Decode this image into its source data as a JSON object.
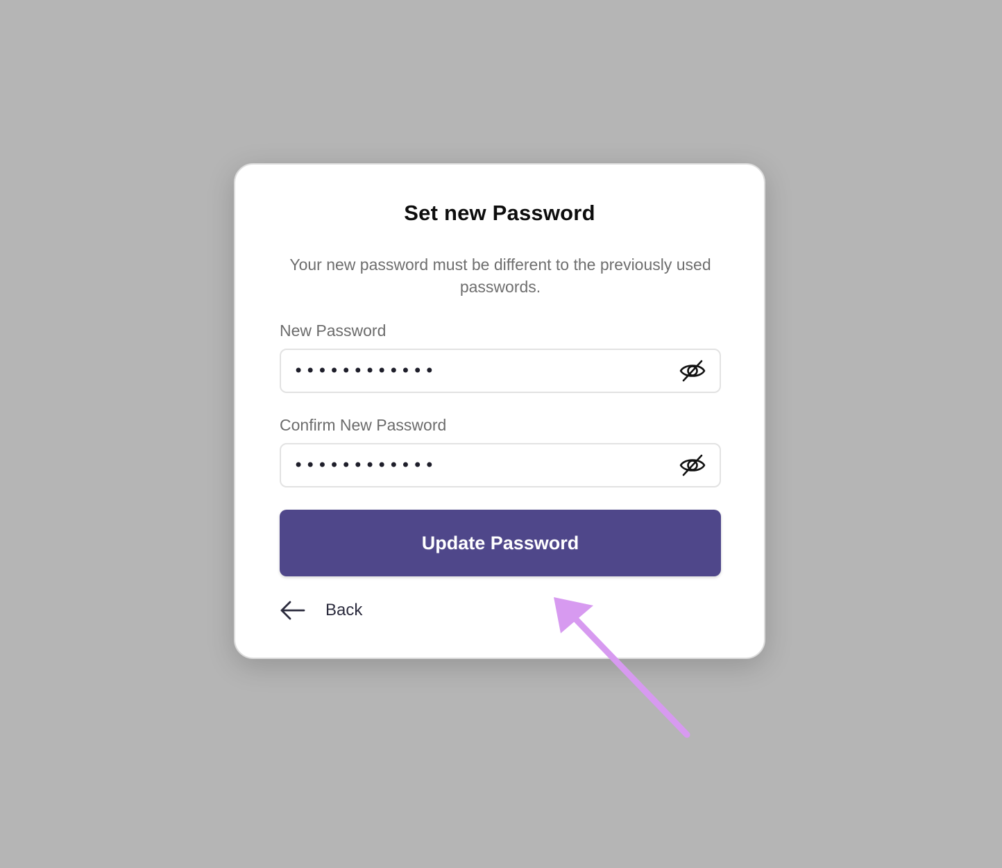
{
  "card": {
    "title": "Set new Password",
    "subtitle": "Your new password must be different to the previously used passwords."
  },
  "new_password": {
    "label": "New Password",
    "value": "••••••••••••",
    "toggle_icon": "eye-off-icon"
  },
  "confirm_password": {
    "label": "Confirm New Password",
    "value": "••••••••••••",
    "toggle_icon": "eye-off-icon"
  },
  "submit": {
    "label": "Update Password",
    "color": "#4f478a"
  },
  "back": {
    "label": "Back",
    "icon": "arrow-left-icon"
  },
  "colors": {
    "background": "#b5b5b5",
    "annotation_arrow": "#d79af0"
  }
}
